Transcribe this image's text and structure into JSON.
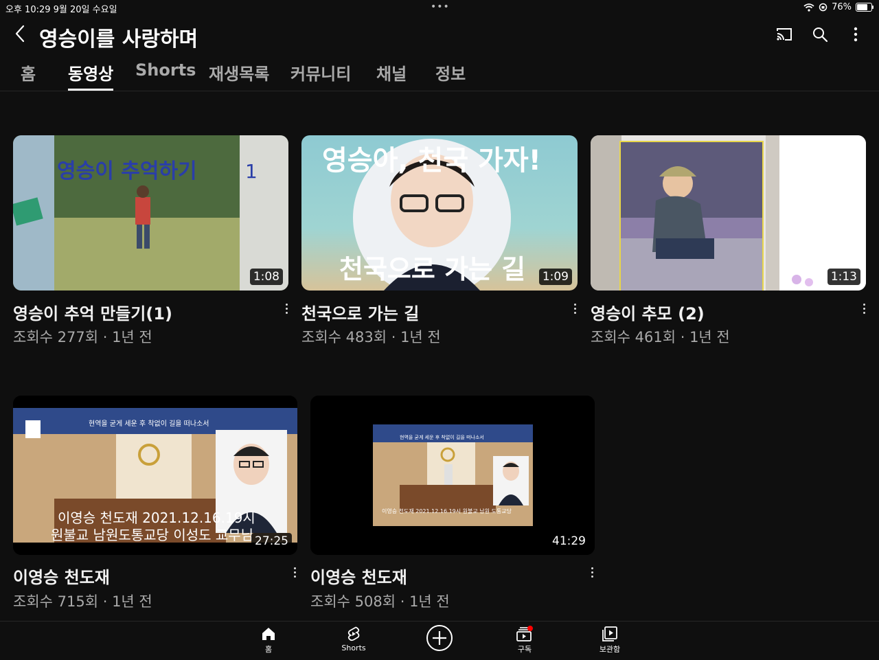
{
  "status_bar": {
    "time": "오후 10:29  9월 20일 수요일",
    "dots": "•••",
    "battery_text": "76%",
    "battery_level": 0.76
  },
  "header": {
    "title": "영승이를 사랑하며",
    "icons": [
      "back-icon",
      "cast-icon",
      "search-icon",
      "more-vert-icon"
    ]
  },
  "tabs": [
    {
      "label": "홈",
      "active": false
    },
    {
      "label": "동영상",
      "active": true
    },
    {
      "label": "Shorts",
      "active": false
    },
    {
      "label": "재생목록",
      "active": false
    },
    {
      "label": "커뮤니티",
      "active": false
    },
    {
      "label": "채널",
      "active": false
    },
    {
      "label": "정보",
      "active": false
    }
  ],
  "videos": [
    {
      "title": "영승이 추억 만들기(1)",
      "meta": "조회수 277회 · 1년 전",
      "duration": "1:08",
      "thumb_text": "영승이 추억하기",
      "thumb_number": "1"
    },
    {
      "title": "천국으로 가는 길",
      "meta": "조회수 483회 · 1년 전",
      "duration": "1:09",
      "thumb_text_top": "영승아, 천국  가자!",
      "thumb_text_bottom": "천국으로 가는 길"
    },
    {
      "title": "영승이 추모 (2)",
      "meta": "조회수 461회 · 1년 전",
      "duration": "1:13"
    },
    {
      "title": "이영승 천도재",
      "meta": "조회수 715회 · 1년 전",
      "duration": "27:25",
      "thumb_banner": "현역을 굳게 세운 후 착없이 길을 떠나소서",
      "thumb_line1": "이영승 천도재 2021.12.16.19시",
      "thumb_line2": "원불교 남원도통교당 이성도 교무님"
    },
    {
      "title": "이영승 천도재",
      "meta": "조회수 508회 · 1년 전",
      "duration": "41:29",
      "thumb_banner": "현역을 굳게 세운 후 착없이 길을 떠나소서",
      "thumb_caption": "이영승 천도재 2021.12.16.19시 원불교 남원 도통교당"
    }
  ],
  "bottom_nav": [
    {
      "label": "홈",
      "icon": "home-icon"
    },
    {
      "label": "Shorts",
      "icon": "shorts-icon"
    },
    {
      "label": "",
      "icon": "create-plus-icon"
    },
    {
      "label": "구독",
      "icon": "subscriptions-icon"
    },
    {
      "label": "보관함",
      "icon": "library-icon"
    }
  ],
  "colors": {
    "background": "#0f0f0f",
    "text_primary": "#f1f1f1",
    "text_secondary": "#aaaaaa",
    "notification_dot": "#ff0000"
  }
}
